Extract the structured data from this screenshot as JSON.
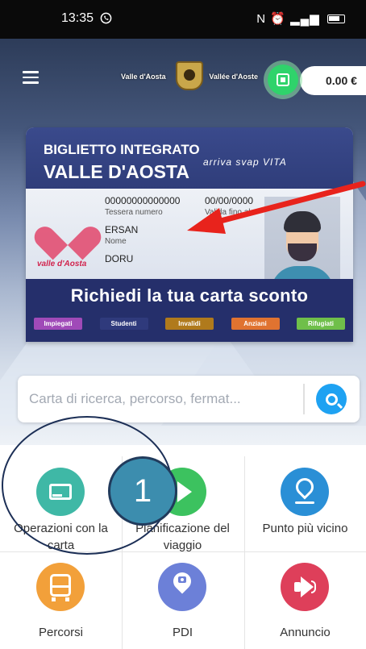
{
  "status_bar": {
    "time": "13:35",
    "whatsapp_icon": "whatsapp-icon",
    "right_icons": "NFC alarm 4G signal battery"
  },
  "header": {
    "menu_icon": "hamburger-icon",
    "brand_left": "Valle d'Aosta",
    "brand_right": "Vallée d'Aoste",
    "qr_icon": "qr-code-icon",
    "wallet_balance": "0.00 €"
  },
  "card": {
    "title_line1": "BIGLIETTO INTEGRATO",
    "title_line2": "VALLE D'AOSTA",
    "partner_logos": "arriva  svap  VITA",
    "card_number": "00000000000000",
    "card_number_label": "Tessera numero",
    "valid_until": "00/00/0000",
    "valid_until_label": "Valida fino al",
    "surname": "ERSAN",
    "surname_label": "Nome",
    "name": "DORU",
    "region_logo_text": "valle d'Aosta",
    "promo_text": "Richiedi la tua carta sconto",
    "categories": [
      {
        "label": "Impiegati",
        "color": "#a04ab8"
      },
      {
        "label": "Studenti",
        "color": "#2f3a7c"
      },
      {
        "label": "Invalidi",
        "color": "#b07a1c"
      },
      {
        "label": "Anziani",
        "color": "#e07330"
      },
      {
        "label": "Rifugiati",
        "color": "#6fbf4a"
      }
    ]
  },
  "search": {
    "placeholder": "Carta di ricerca, percorso, fermat...",
    "icon": "search-icon"
  },
  "menu": [
    {
      "label": "Operazioni con la carta",
      "icon": "card-icon",
      "color": "#3fb8a6"
    },
    {
      "label": "Pianificazione del viaggio",
      "icon": "route-arrow-icon",
      "color": "#3cc25f"
    },
    {
      "label": "Punto più vicino",
      "icon": "location-pin-icon",
      "color": "#2a8fd6"
    },
    {
      "label": "Percorsi",
      "icon": "bus-icon",
      "color": "#f2a03a"
    },
    {
      "label": "PDI",
      "icon": "poi-pin-icon",
      "color": "#6c80d8"
    },
    {
      "label": "Annuncio",
      "icon": "megaphone-icon",
      "color": "#de3f5a"
    }
  ],
  "annotation": {
    "step_number": "1"
  },
  "colors": {
    "accent_green": "#2fd36b",
    "search_blue": "#1ea2f2",
    "card_header": "#2f3d7a",
    "arrow_red": "#e8231c"
  }
}
